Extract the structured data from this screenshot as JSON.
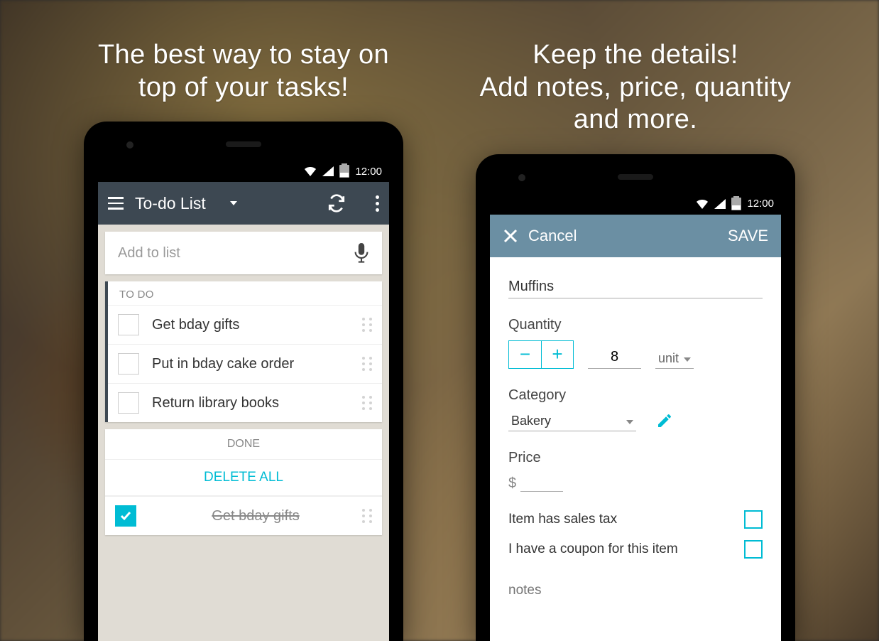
{
  "panel1": {
    "headline_l1": "The best way to stay on",
    "headline_l2": "top of your tasks!",
    "time": "12:00",
    "list_title": "To-do List",
    "add_placeholder": "Add to list",
    "todo_header": "TO DO",
    "todo": [
      "Get bday gifts",
      "Put in bday cake order",
      "Return library books"
    ],
    "done_header": "DONE",
    "delete_all": "DELETE ALL",
    "done": [
      "Get bday gifts"
    ]
  },
  "panel2": {
    "headline_l1": "Keep the details!",
    "headline_l2": "Add notes, price, quantity",
    "headline_l3": "and more.",
    "time": "12:00",
    "cancel": "Cancel",
    "save": "SAVE",
    "item_name": "Muffins",
    "qty_label": "Quantity",
    "qty_value": "8",
    "unit": "unit",
    "cat_label": "Category",
    "cat_value": "Bakery",
    "price_label": "Price",
    "currency": "$",
    "tax_label": "Item has sales tax",
    "coupon_label": "I have a coupon for this item",
    "notes_placeholder": "notes"
  }
}
